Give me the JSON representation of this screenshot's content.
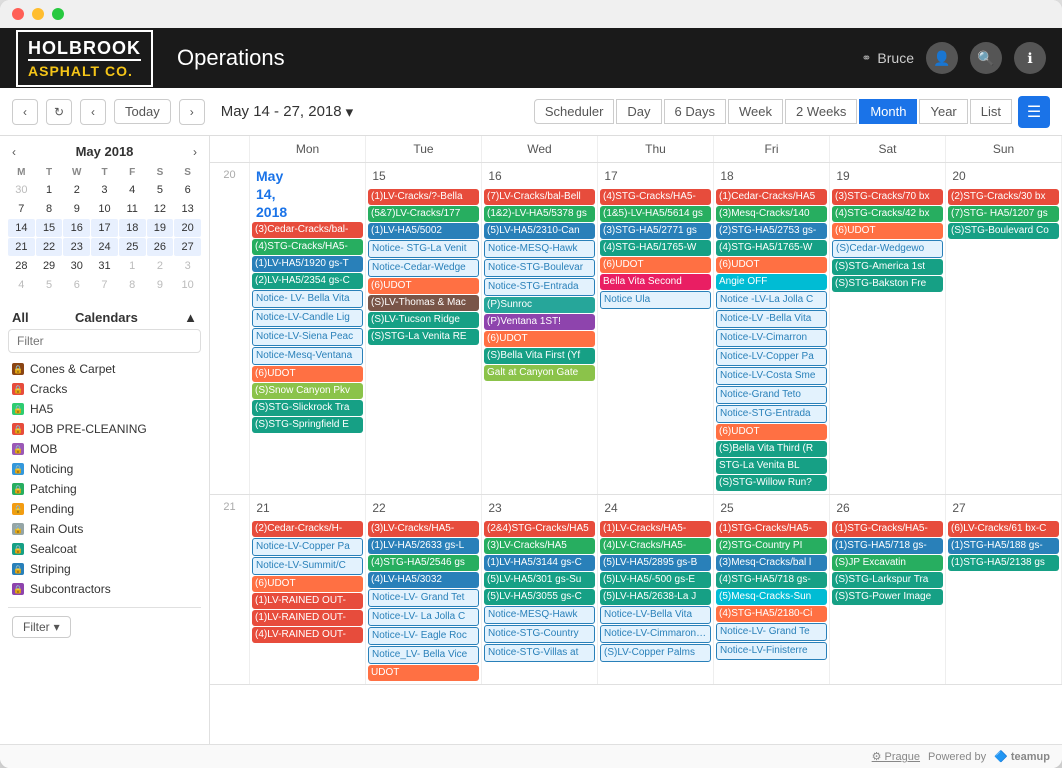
{
  "app": {
    "title": "Operations",
    "logo_top": "HOLBROOK",
    "logo_bottom": "ASPHALT CO.",
    "user": "Bruce"
  },
  "nav": {
    "prev_month": "‹",
    "next_month": "›",
    "mini_cal_title": "May 2018",
    "today": "Today",
    "date_range": "May 14 - 27, 2018",
    "views": [
      "Scheduler",
      "Day",
      "6 Days",
      "Week",
      "2 Weeks",
      "Month",
      "Year",
      "List"
    ],
    "active_view": "Month"
  },
  "mini_cal": {
    "days_header": [
      "M",
      "T",
      "W",
      "T",
      "F",
      "S",
      "S"
    ],
    "weeks": [
      [
        {
          "n": "30",
          "other": true
        },
        {
          "n": "1"
        },
        {
          "n": "2"
        },
        {
          "n": "3"
        },
        {
          "n": "4"
        },
        {
          "n": "5"
        },
        {
          "n": "6"
        }
      ],
      [
        {
          "n": "7"
        },
        {
          "n": "8"
        },
        {
          "n": "9"
        },
        {
          "n": "10"
        },
        {
          "n": "11"
        },
        {
          "n": "12"
        },
        {
          "n": "13"
        }
      ],
      [
        {
          "n": "14",
          "sel": true
        },
        {
          "n": "15",
          "sel": true
        },
        {
          "n": "16",
          "sel": true
        },
        {
          "n": "17",
          "sel": true
        },
        {
          "n": "18",
          "sel": true
        },
        {
          "n": "19",
          "sel": true
        },
        {
          "n": "20",
          "sel": true
        }
      ],
      [
        {
          "n": "21",
          "sel": true
        },
        {
          "n": "22",
          "sel": true
        },
        {
          "n": "23",
          "sel": true
        },
        {
          "n": "24",
          "sel": true
        },
        {
          "n": "25",
          "sel": true
        },
        {
          "n": "26",
          "sel": true
        },
        {
          "n": "27",
          "sel": true
        }
      ],
      [
        {
          "n": "28"
        },
        {
          "n": "29"
        },
        {
          "n": "30"
        },
        {
          "n": "31"
        },
        {
          "n": "1",
          "other": true
        },
        {
          "n": "2",
          "other": true
        },
        {
          "n": "3",
          "other": true
        }
      ],
      [
        {
          "n": "4",
          "other": true
        },
        {
          "n": "5",
          "other": true
        },
        {
          "n": "6",
          "other": true
        },
        {
          "n": "7",
          "other": true
        },
        {
          "n": "8",
          "other": true
        },
        {
          "n": "9",
          "other": true
        },
        {
          "n": "10",
          "other": true
        }
      ]
    ]
  },
  "sidebar": {
    "calendars_label": "Calendars",
    "filter_placeholder": "Filter",
    "all_label": "All",
    "items": [
      {
        "label": "Cones & Carpet",
        "color": "#8B4513"
      },
      {
        "label": "Cracks",
        "color": "#e74c3c"
      },
      {
        "label": "HA5",
        "color": "#2ecc71"
      },
      {
        "label": "JOB PRE-CLEANING",
        "color": "#e74c3c"
      },
      {
        "label": "MOB",
        "color": "#9b59b6"
      },
      {
        "label": "Noticing",
        "color": "#3498db"
      },
      {
        "label": "Patching",
        "color": "#27ae60"
      },
      {
        "label": "Pending",
        "color": "#f39c12"
      },
      {
        "label": "Rain Outs",
        "color": "#95a5a6"
      },
      {
        "label": "Sealcoat",
        "color": "#16a085"
      },
      {
        "label": "Striping",
        "color": "#2980b9"
      },
      {
        "label": "Subcontractors",
        "color": "#8e44ad"
      }
    ],
    "filter_btn": "Filter"
  },
  "calendar": {
    "day_headers": [
      "Mon",
      "Tue",
      "Wed",
      "Thu",
      "Fri",
      "Sat",
      "Sun"
    ],
    "week_nums": [
      "20",
      "21"
    ]
  },
  "footer": {
    "prague": "Prague",
    "powered": "Powered by",
    "teamup": "teamup"
  }
}
